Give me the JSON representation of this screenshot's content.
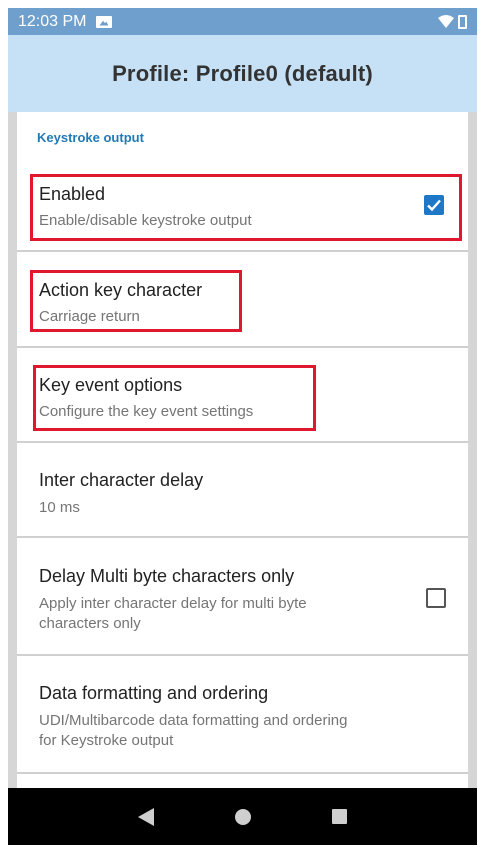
{
  "status_bar": {
    "time": "12:03 PM",
    "icons": [
      "image-icon",
      "wifi-icon",
      "battery-icon"
    ]
  },
  "app_bar": {
    "title": "Profile: Profile0 (default)"
  },
  "section": {
    "category": "Keystroke output"
  },
  "preferences": [
    {
      "title": "Enabled",
      "summary": "Enable/disable keystroke output",
      "checkbox": "checked"
    },
    {
      "title": "Action key character",
      "summary": "Carriage return"
    },
    {
      "title": "Key event options",
      "summary": "Configure the key event settings"
    },
    {
      "title": "Inter character delay",
      "summary": "10 ms"
    },
    {
      "title": "Delay Multi byte characters only",
      "summary_line1": "Apply inter character delay for multi byte",
      "summary_line2": "characters only",
      "checkbox": "unchecked"
    },
    {
      "title": "Data formatting and ordering",
      "summary_line1": "UDI/Multibarcode data formatting and ordering",
      "summary_line2": "for Keystroke output"
    }
  ],
  "nav_bar": {
    "icons": [
      "back-icon",
      "home-icon",
      "recents-icon"
    ]
  },
  "colors": {
    "status_bar": "#6f9fcc",
    "app_bar": "#c6e1f5",
    "accent": "#1f77c7",
    "highlight": "#e0182d"
  }
}
